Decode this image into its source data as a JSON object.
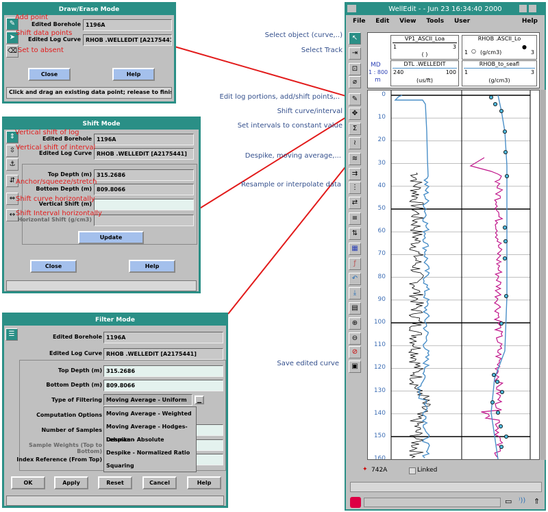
{
  "draw_erase": {
    "title": "Draw/Erase Mode",
    "borehole_label": "Edited Borehole",
    "borehole_value": "1196A",
    "curve_label": "Edited Log Curve",
    "curve_value": "RHOB .WELLEDIT [A2175441]",
    "close": "Close",
    "help": "Help",
    "status": "Click and drag an existing data point; release to finish",
    "notes": [
      "Add point",
      "Shift data points",
      "Set to absent"
    ]
  },
  "shift": {
    "title": "Shift Mode",
    "borehole_label": "Edited Borehole",
    "borehole_value": "1196A",
    "curve_label": "Edited Log Curve",
    "curve_value": "RHOB .WELLEDIT [A2175441]",
    "top_label": "Top Depth (m)",
    "top_value": "315.2686",
    "bottom_label": "Bottom Depth (m)",
    "bottom_value": "809.8066",
    "vshift_label": "Vertical Shift (m)",
    "hshift_label": "Horizontal Shift (g/cm3)",
    "update": "Update",
    "close": "Close",
    "help": "Help",
    "notes": [
      "Vertical shift of log",
      "Vertical shift of interval",
      "Anchor/squeeze/stretch",
      "Shift curve horizontally",
      "Shift Interval horizontally"
    ]
  },
  "filter": {
    "title": "Filter Mode",
    "borehole_label": "Edited Borehole",
    "borehole_value": "1196A",
    "curve_label": "Edited Log Curve",
    "curve_value": "RHOB .WELLEDIT [A2175441]",
    "top_label": "Top Depth (m)",
    "top_value": "315.2686",
    "bottom_label": "Bottom Depth (m)",
    "bottom_value": "809.8066",
    "type_label": "Type of Filtering",
    "type_value": "Moving Average - Uniform",
    "options_label": "Computation Options",
    "samples_label": "Number of Samples",
    "weights_label": "Sample Weights (Top to Bottom)",
    "index_label": "Index Reference (From Top)",
    "dropdown_options": [
      "Moving Average - Weighted",
      "Moving Average - Hodges-Lehmann",
      "Despike - Absolute",
      "Despike - Normalized Ratio",
      "Squaring"
    ],
    "ok": "OK",
    "apply": "Apply",
    "reset": "Reset",
    "cancel": "Cancel",
    "help": "Help"
  },
  "annotations": {
    "select_object": "Select object (curve,..)",
    "select_track": "Select Track",
    "edit_log": "Edit log portions, add/shift points,..",
    "shift_curve": "Shift curve/interval",
    "set_const": "Set intervals to constant value",
    "despike": "Despike, moving average,...",
    "resample": "Resample or interpolate data",
    "save": "Save edited curve"
  },
  "welledit": {
    "title": "WellEdit - - Jun 23 16:34:40 2000",
    "menu": [
      "File",
      "Edit",
      "View",
      "Tools",
      "User"
    ],
    "help_menu": "Help",
    "md_label": "MD",
    "md_scale": "1 : 800",
    "md_unit": "m",
    "track1": {
      "curve1_name": "VP1_ASCII_Loa",
      "curve1_min": "1",
      "curve1_max": "3",
      "curve1_unit": "( )",
      "curve2_name": "DTL .WELLEDIT",
      "curve2_min": "240",
      "curve2_max": "100",
      "curve2_unit": "(us/ft)"
    },
    "track2": {
      "curve1_name": "RHOB .ASCII_Lo",
      "curve1_min": "1",
      "curve1_max": "3",
      "curve1_unit": "(g/cm3)",
      "curve2_name": "RHOB_to_seafl",
      "curve2_min": "1",
      "curve2_max": "3",
      "curve2_unit": "(g/cm3)"
    },
    "depth_ticks": [
      "0",
      "10",
      "20",
      "30",
      "40",
      "50",
      "60",
      "70",
      "80",
      "90",
      "100",
      "110",
      "120",
      "130",
      "140",
      "150",
      "160"
    ],
    "bottom_id": "742A",
    "linked": "Linked",
    "colors": {
      "teal": "#2a8f86",
      "blue_curve": "#4a8fc8",
      "magenta_curve": "#c0148a",
      "annotation": "#334f8c",
      "note_red": "#e21b1b",
      "pointer_line": "#e21b1b"
    }
  }
}
